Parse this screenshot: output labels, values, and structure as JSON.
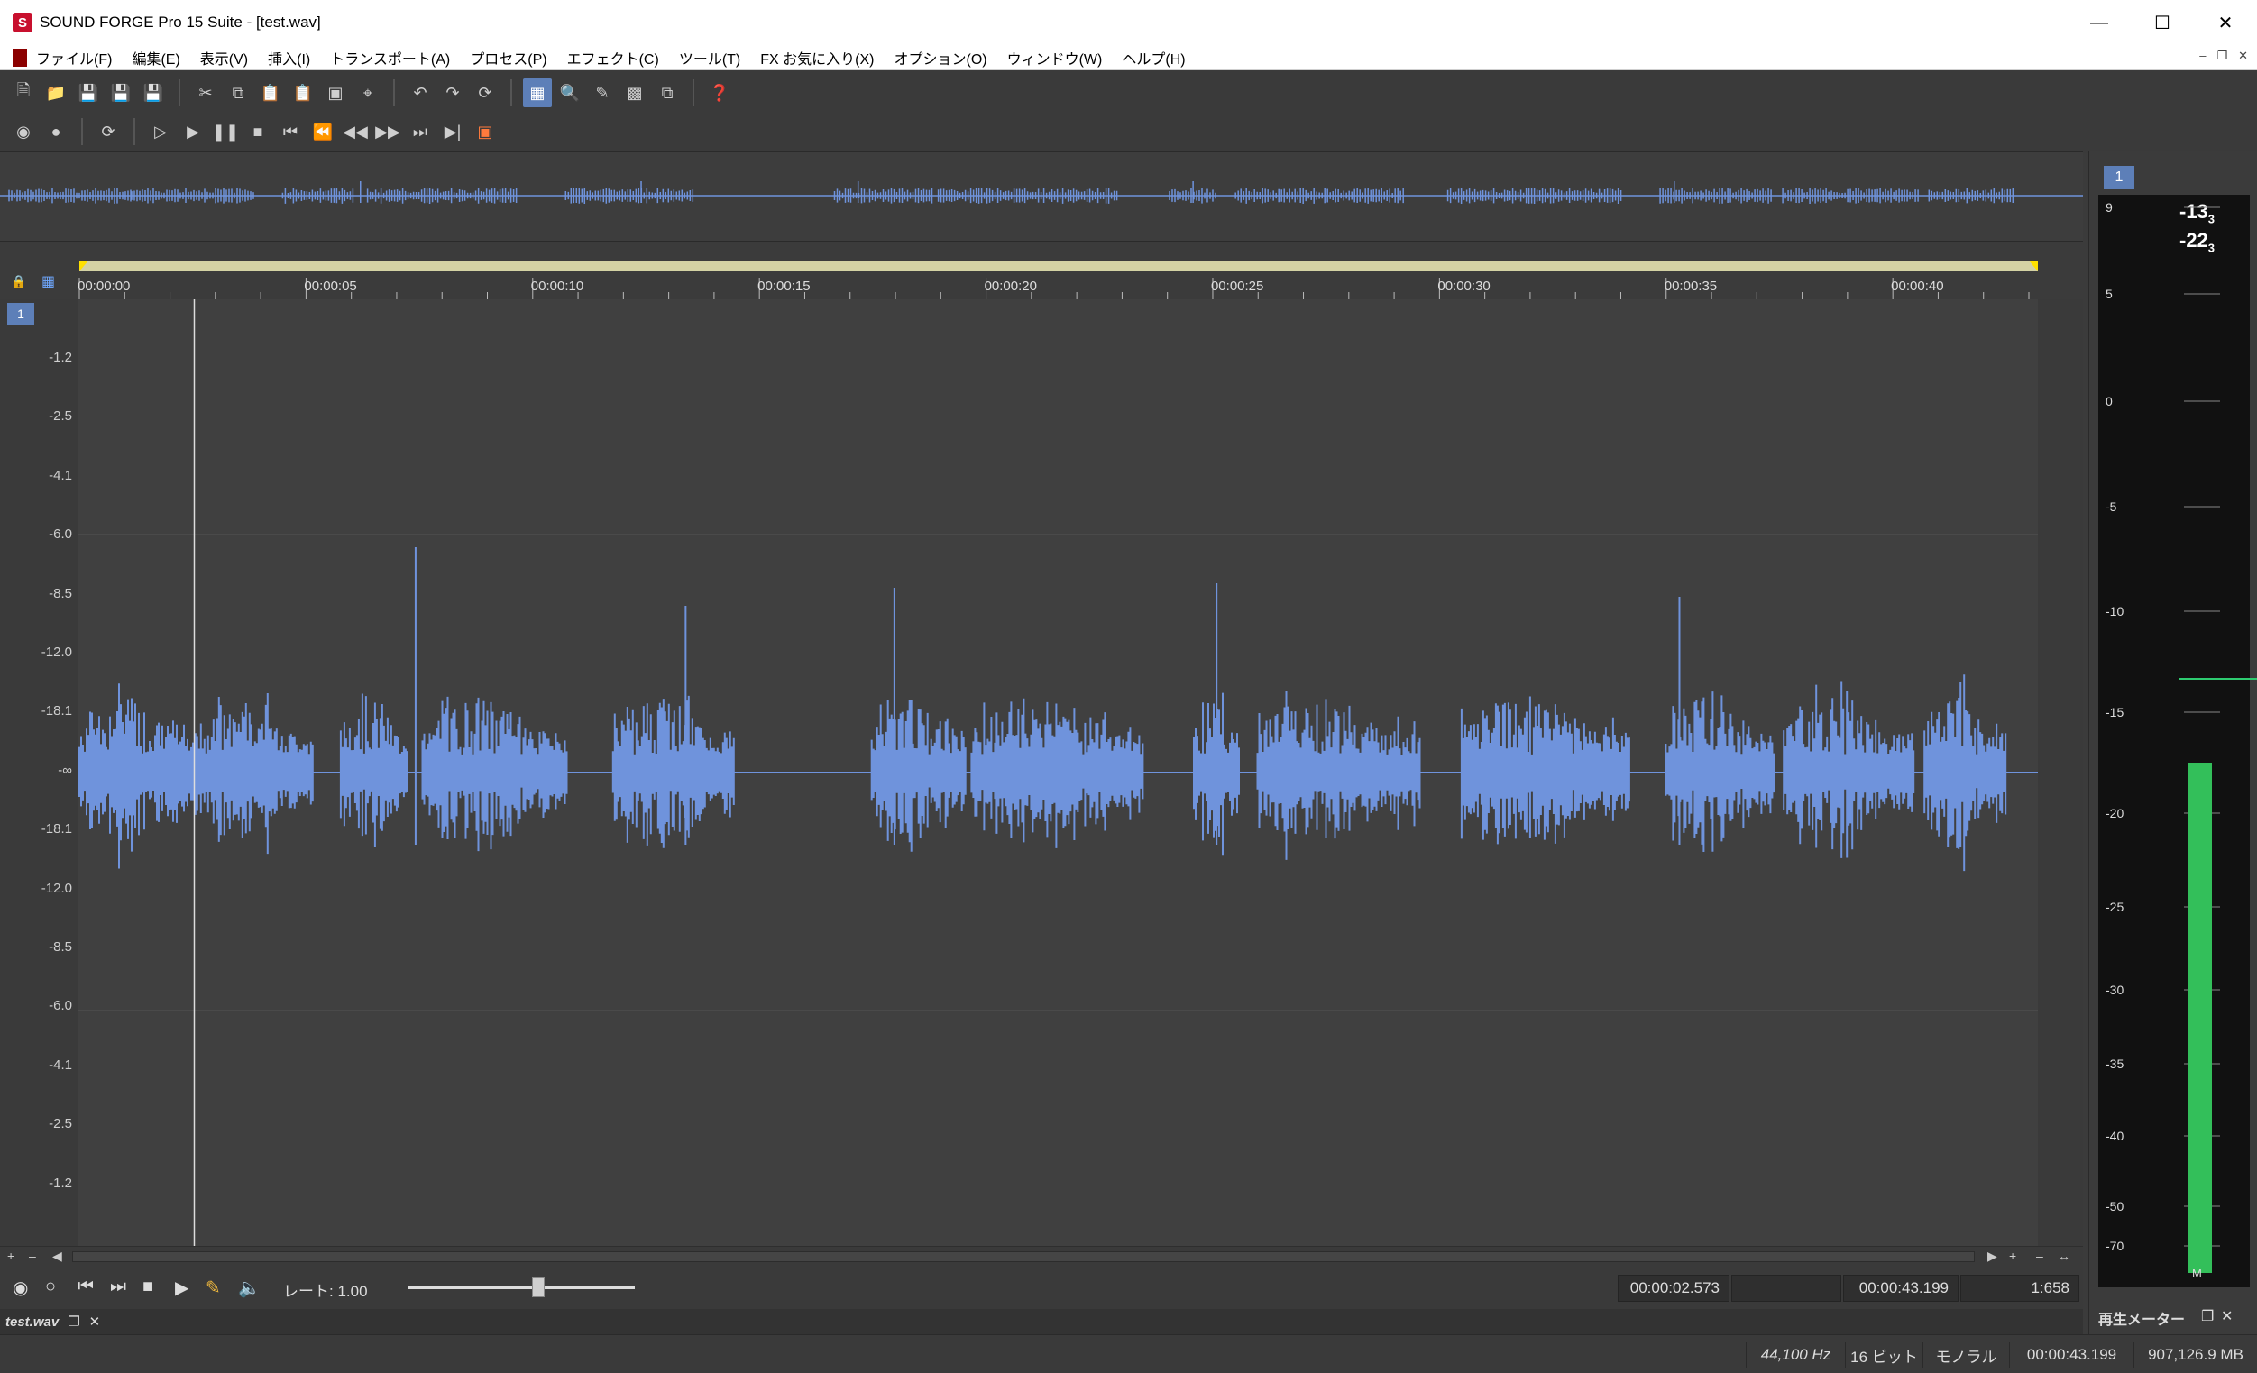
{
  "window": {
    "title": "SOUND FORGE Pro 15 Suite - [test.wav]",
    "app_icon": "S",
    "controls": [
      "minimize-icon",
      "maximize-icon",
      "close-icon"
    ]
  },
  "menu": {
    "items": [
      "ファイル(F)",
      "編集(E)",
      "表示(V)",
      "挿入(I)",
      "トランスポート(A)",
      "プロセス(P)",
      "エフェクト(C)",
      "ツール(T)",
      "FX お気に入り(X)",
      "オプション(O)",
      "ウィンドウ(W)",
      "ヘルプ(H)"
    ]
  },
  "toolbar": {
    "row1_icons": [
      "new-icon",
      "open-icon",
      "save-icon",
      "save-as-icon",
      "save-all-icon",
      "cut-icon",
      "copy-icon",
      "paste-icon",
      "paste-special-icon",
      "mix-icon",
      "crop-icon",
      "undo-icon",
      "redo-icon",
      "repeat-icon",
      "edit-tool-icon",
      "magnify-tool-icon",
      "pencil-tool-icon",
      "event-tool-icon",
      "envelope-tool-icon",
      "help-icon"
    ],
    "row2_icons": [
      "record-arm-icon",
      "record-icon",
      "loop-icon",
      "play-all-icon",
      "play-icon",
      "pause-icon",
      "stop-icon",
      "go-start-icon",
      "rewind-icon",
      "fast-rewind-icon",
      "fast-forward-icon",
      "go-end-icon",
      "next-marker-icon",
      "sync-icon"
    ]
  },
  "timeline": {
    "ticks": [
      "00:00:00",
      "00:00:05",
      "00:00:10",
      "00:00:15",
      "00:00:20",
      "00:00:25",
      "00:00:30",
      "00:00:35",
      "00:00:40"
    ],
    "duration_seconds": 43.199,
    "cursor_seconds": 2.573
  },
  "waveform": {
    "channel_label": "1",
    "db_labels": [
      "-1.2",
      "-2.5",
      "-4.1",
      "-6.0",
      "-8.5",
      "-12.0",
      "-18.1",
      "-∞",
      "-18.1",
      "-12.0",
      "-8.5",
      "-6.0",
      "-4.1",
      "-2.5",
      "-1.2"
    ],
    "color": "#6f93dc",
    "background": "#404040"
  },
  "transport": {
    "rate_label": "レート: 1.00",
    "rate_value": 1.0,
    "cursor_time": "00:00:02.573",
    "selection_time": "",
    "length_time": "00:00:43.199",
    "zoom_ratio": "1:658"
  },
  "doc_tab": {
    "name": "test.wav"
  },
  "meter": {
    "channel_label": "1",
    "peak_main": "-13",
    "peak_main_sub": "3",
    "peak_rms": "-22",
    "peak_rms_sub": "3",
    "scale": [
      "9",
      "5",
      "0",
      "-5",
      "-10",
      "-15",
      "-20",
      "-25",
      "-30",
      "-35",
      "-40",
      "-50",
      "-70"
    ],
    "level_db": -17.5,
    "hold_db": -13.3,
    "mono_label": "M",
    "panel_title": "再生メーター",
    "bar_color": "#33bf5a"
  },
  "status": {
    "sample_rate": "44,100 Hz",
    "bit_depth": "16 ビット",
    "channels": "モノラル",
    "length": "00:00:43.199",
    "disk_space": "907,126.9 MB"
  }
}
